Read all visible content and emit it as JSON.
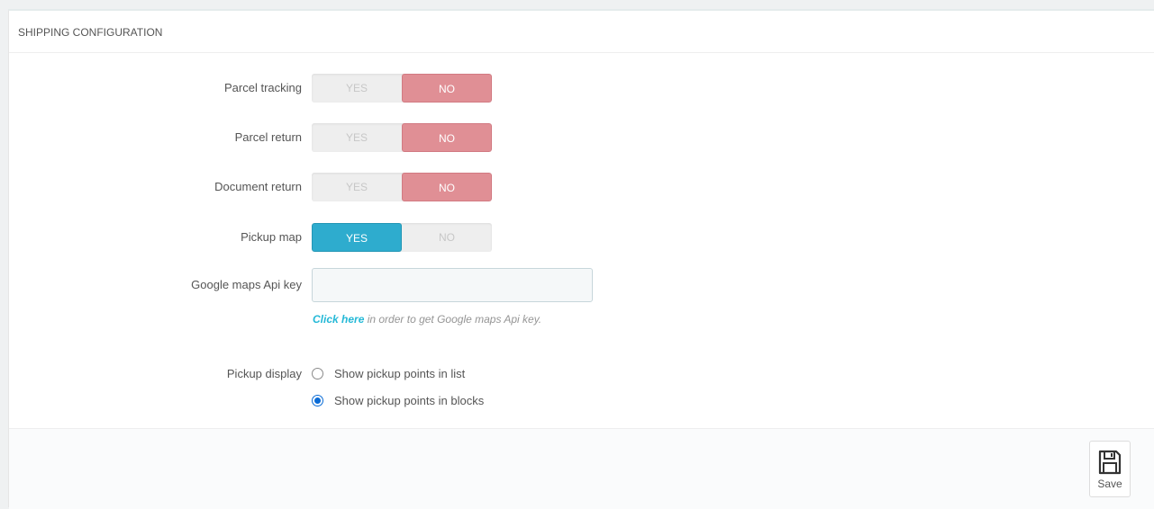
{
  "panel": {
    "title": "SHIPPING CONFIGURATION"
  },
  "fields": {
    "parcel_tracking": {
      "label": "Parcel tracking",
      "yes_label": "YES",
      "no_label": "NO",
      "value": "NO"
    },
    "parcel_return": {
      "label": "Parcel return",
      "yes_label": "YES",
      "no_label": "NO",
      "value": "NO"
    },
    "document_return": {
      "label": "Document return",
      "yes_label": "YES",
      "no_label": "NO",
      "value": "NO"
    },
    "pickup_map": {
      "label": "Pickup map",
      "yes_label": "YES",
      "no_label": "NO",
      "value": "YES"
    },
    "google_maps_api_key": {
      "label": "Google maps Api key",
      "value": "",
      "help_link": "Click here",
      "help_text": " in order to get Google maps Api key."
    },
    "pickup_display": {
      "label": "Pickup display",
      "options": [
        {
          "label": "Show pickup points in list",
          "checked": false
        },
        {
          "label": "Show pickup points in blocks",
          "checked": true
        }
      ]
    }
  },
  "footer": {
    "save_label": "Save"
  },
  "colors": {
    "no_active": "#e08f95",
    "yes_active": "#2eacce",
    "link": "#25b9d7"
  },
  "icons": {
    "save": "floppy-disk-icon",
    "radio": "radio-button"
  }
}
